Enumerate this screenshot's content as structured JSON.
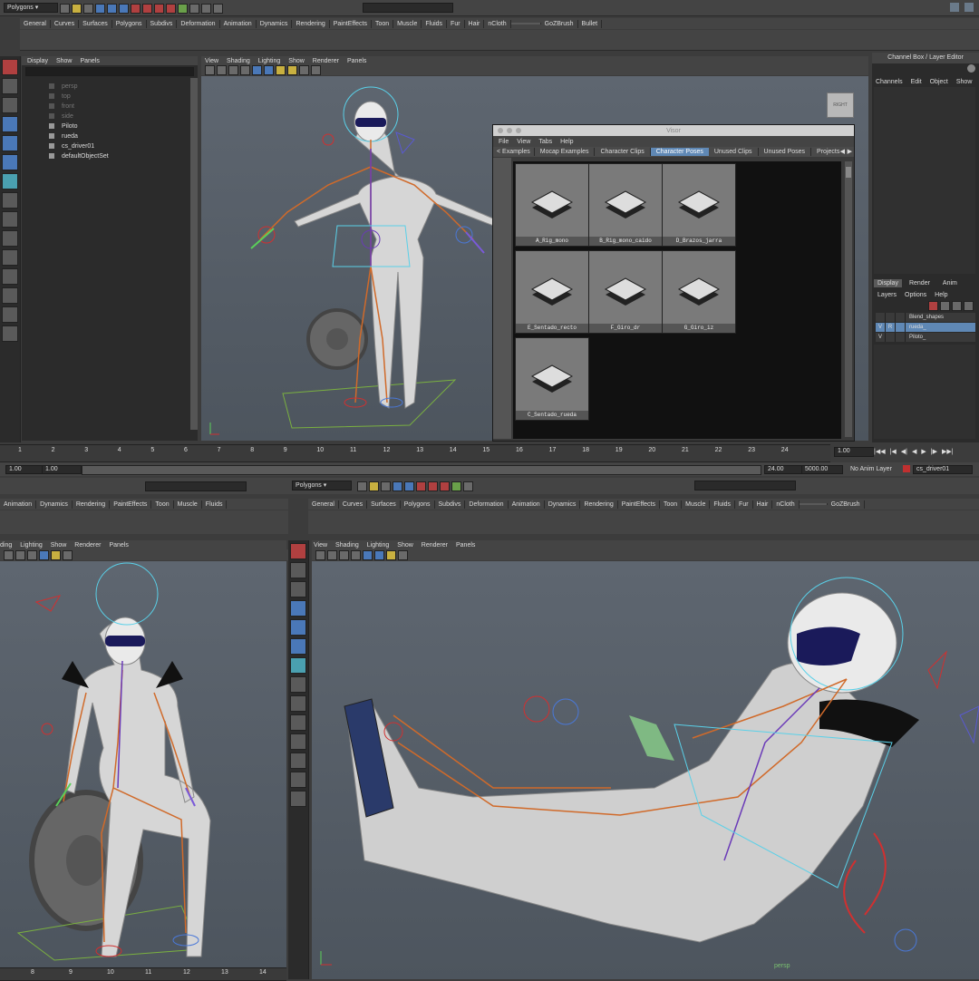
{
  "top": {
    "mode_select": "Polygons",
    "shelf_tabs": [
      "General",
      "Curves",
      "Surfaces",
      "Polygons",
      "Subdivs",
      "Deformation",
      "Animation",
      "Dynamics",
      "Rendering",
      "PaintEffects",
      "Toon",
      "Muscle",
      "Fluids",
      "Fur",
      "Hair",
      "nCloth",
      "",
      "GoZBrush",
      "Bullet"
    ],
    "outliner_menu": [
      "Display",
      "Show",
      "Panels"
    ],
    "outliner_items": [
      {
        "label": "persp",
        "dim": true
      },
      {
        "label": "top",
        "dim": true
      },
      {
        "label": "front",
        "dim": true
      },
      {
        "label": "side",
        "dim": true
      },
      {
        "label": "Piloto",
        "dim": false
      },
      {
        "label": "rueda",
        "dim": false
      },
      {
        "label": "cs_driver01",
        "dim": false
      },
      {
        "label": "defaultObjectSet",
        "dim": false
      }
    ],
    "viewport_menu": [
      "View",
      "Shading",
      "Lighting",
      "Show",
      "Renderer",
      "Panels"
    ],
    "view_cube_label": "RIGHT",
    "channel_box_title": "Channel Box / Layer Editor",
    "channel_menu": [
      "Channels",
      "Edit",
      "Object",
      "Show"
    ],
    "layer_tabs": [
      "Display",
      "Render",
      "Anim"
    ],
    "layer_menu": [
      "Layers",
      "Options",
      "Help"
    ],
    "layers": [
      {
        "v": "",
        "r": "",
        "name": "Blend_shapes",
        "selected": false
      },
      {
        "v": "V",
        "r": "R",
        "name": "rueda_",
        "selected": true
      },
      {
        "v": "V",
        "r": "",
        "name": "Piloto_",
        "selected": false
      }
    ],
    "timeline_ticks": [
      "1",
      "2",
      "3",
      "4",
      "5",
      "6",
      "7",
      "8",
      "9",
      "10",
      "11",
      "12",
      "13",
      "14",
      "15",
      "16",
      "17",
      "18",
      "19",
      "20",
      "21",
      "22",
      "23",
      "24"
    ],
    "current_frame": "1.00",
    "range_start": "1.00",
    "range_start2": "1.00",
    "range_end": "24.00",
    "range_end2": "5000.00",
    "anim_layer": "No Anim Layer",
    "char_set": "cs_driver01"
  },
  "visor": {
    "title": "Visor",
    "menu": [
      "File",
      "View",
      "Tabs",
      "Help"
    ],
    "tabs": [
      "< Examples",
      "Mocap Examples",
      "Character Clips",
      "Character Poses",
      "Unused Clips",
      "Unused Poses",
      "Projects"
    ],
    "selected_tab": "Character Poses",
    "poses": [
      "A_Rig_mono",
      "B_Rig_mono_caido",
      "D_Brazos_jarra",
      "E_Sentado_recto",
      "F_Giro_dr",
      "G_Giro_iz",
      "C_Sentado_rueda"
    ]
  },
  "bottom_left": {
    "shelf_tabs": [
      "Animation",
      "Dynamics",
      "Rendering",
      "PaintEffects",
      "Toon",
      "Muscle",
      "Fluids"
    ],
    "viewport_menu": [
      "ding",
      "Lighting",
      "Show",
      "Renderer",
      "Panels"
    ],
    "ruler_ticks": [
      "8",
      "9",
      "10",
      "11",
      "12",
      "13",
      "14"
    ]
  },
  "bottom_right": {
    "mode_select": "Polygons",
    "shelf_tabs": [
      "General",
      "Curves",
      "Surfaces",
      "Polygons",
      "Subdivs",
      "Deformation",
      "Animation",
      "Dynamics",
      "Rendering",
      "PaintEffects",
      "Toon",
      "Muscle",
      "Fluids",
      "Fur",
      "Hair",
      "nCloth",
      "",
      "GoZBrush"
    ],
    "viewport_menu": [
      "View",
      "Shading",
      "Lighting",
      "Show",
      "Renderer",
      "Panels"
    ],
    "camera_label": "persp"
  },
  "colors": {
    "accent_selected": "#5f88b5",
    "joint_orange": "#d06a2a",
    "joint_purple": "#6a3ab8",
    "control_cyan": "#5ad0e8",
    "control_red": "#d03030"
  }
}
